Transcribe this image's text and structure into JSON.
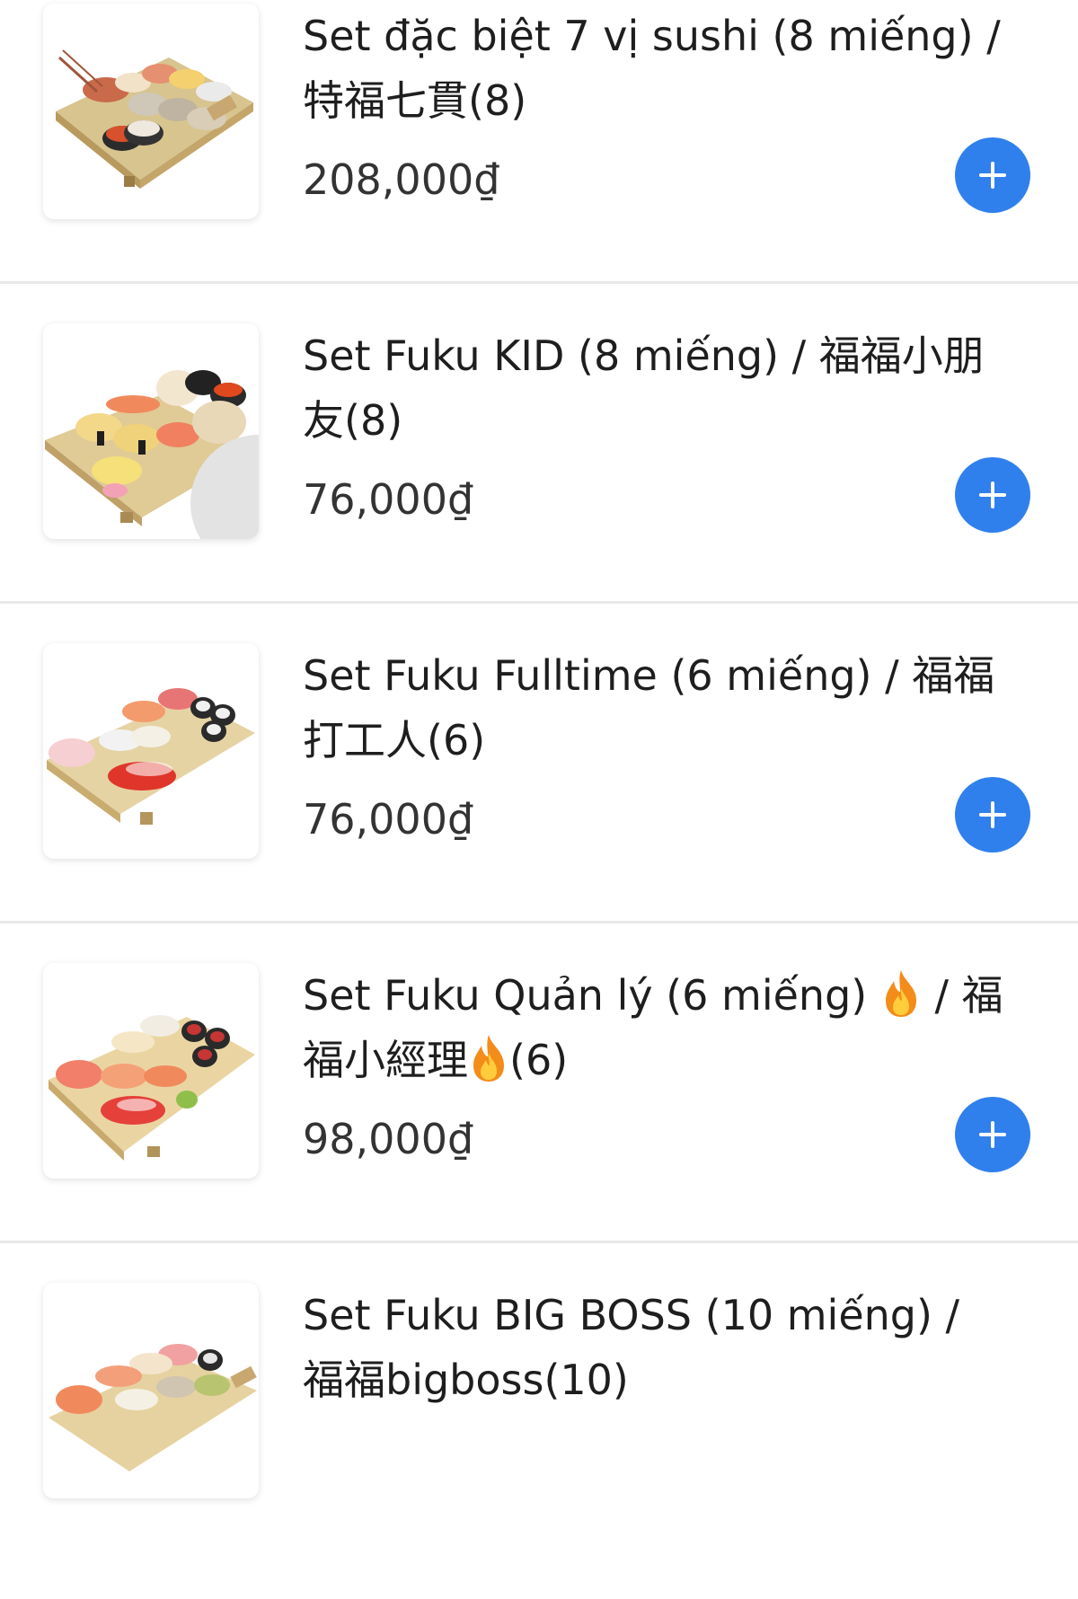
{
  "menu": {
    "items": [
      {
        "name_before_flame": "Set đặc biệt 7 vị sushi (8 miếng) / 特福七貫(8)",
        "price": "208,000₫",
        "image_icon": "sushi-platter-image",
        "add_icon": "plus-icon"
      },
      {
        "name_before_flame": "Set Fuku KID (8 miếng) / 福福小朋友(8)",
        "price": "76,000₫",
        "image_icon": "sushi-platter-image",
        "add_icon": "plus-icon"
      },
      {
        "name_before_flame": "Set Fuku Fulltime (6 miếng) / 福福打工人(6)",
        "price": "76,000₫",
        "image_icon": "sushi-platter-image",
        "add_icon": "plus-icon"
      },
      {
        "name_before_flame": "Set Fuku Quản lý (6 miếng) ",
        "name_middle": " / 福福小經理",
        "name_after_flame": "(6)",
        "price": "98,000₫",
        "image_icon": "sushi-platter-image",
        "add_icon": "plus-icon",
        "flame_icon": "fire-emoji-icon"
      },
      {
        "name_before_flame": "Set Fuku BIG BOSS (10 miếng) / 福福bigboss(10)",
        "price": "",
        "image_icon": "sushi-platter-image",
        "add_icon": "plus-icon"
      }
    ]
  },
  "colors": {
    "accent": "#2f80ed",
    "divider": "#e8e8e8",
    "text": "#1e1e1e",
    "price": "#333333"
  }
}
